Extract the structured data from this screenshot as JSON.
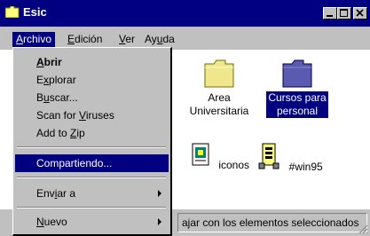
{
  "window": {
    "title": "Esic",
    "buttons": [
      "minimize-icon",
      "maximize-icon",
      "close-icon"
    ]
  },
  "menubar": {
    "items": [
      {
        "label": "Archivo",
        "mnemonic_index": 0
      },
      {
        "label": "Edición",
        "mnemonic_index": 0
      },
      {
        "label": "Ver",
        "mnemonic_index": 0
      },
      {
        "label": "Ayuda",
        "mnemonic_index": 2
      }
    ]
  },
  "archivo_menu": {
    "items": [
      {
        "label": "Abrir",
        "bold": true
      },
      {
        "label": "Explorar"
      },
      {
        "label": "Buscar..."
      },
      {
        "label": "Scan for Viruses"
      },
      {
        "label": "Add to Zip"
      },
      {
        "label": "Compartiendo...",
        "highlighted": true
      },
      {
        "label": "Enviar a",
        "submenu": true
      },
      {
        "label": "Nuevo",
        "submenu": true
      }
    ]
  },
  "content": {
    "icons": [
      {
        "label_line1": "Area",
        "label_line2": "Universitaria",
        "icon": "folder-icon",
        "selected": false
      },
      {
        "label_line1": "Cursos para",
        "label_line2": "personal",
        "icon": "folder-icon",
        "selected": true
      },
      {
        "label_line1": "iconos",
        "label_line2": "",
        "icon": "document-icon",
        "selected": false
      },
      {
        "label_line1": "#win95",
        "label_line2": "",
        "icon": "compressed-file-icon",
        "selected": false
      }
    ]
  },
  "statusbar": {
    "text": "ajar con los elementos seleccionados"
  },
  "colors": {
    "titlebar": "#000080",
    "face": "#c0c0c0",
    "highlight": "#000080",
    "folder": "#f0e68c",
    "selected_folder": "#5a5ab0"
  }
}
